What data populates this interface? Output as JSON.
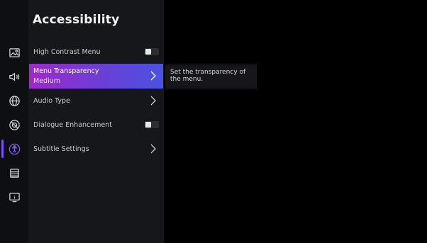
{
  "page": {
    "title": "Accessibility"
  },
  "menu": [
    {
      "label": "High Contrast Menu",
      "control": "toggle",
      "on": false
    },
    {
      "label": "Menu Transparency",
      "value": "Medium",
      "control": "chevron",
      "selected": true
    },
    {
      "label": "Audio Type",
      "control": "chevron"
    },
    {
      "label": "Dialogue Enhancement",
      "control": "toggle",
      "on": false
    },
    {
      "label": "Subtitle Settings",
      "control": "chevron"
    }
  ],
  "tooltip": {
    "text": "Set the transparency of the menu."
  },
  "sidebar": {
    "icons": [
      "picture-icon",
      "sound-icon",
      "network-icon",
      "privacy-icon",
      "accessibility-icon",
      "list-icon",
      "info-icon"
    ],
    "active": "accessibility-icon"
  },
  "colors": {
    "accent_start": "#9d2ac9",
    "accent_end": "#4a52e0",
    "active_icon": "#7b4dff",
    "background": "#000000",
    "panel": "#16171b"
  }
}
